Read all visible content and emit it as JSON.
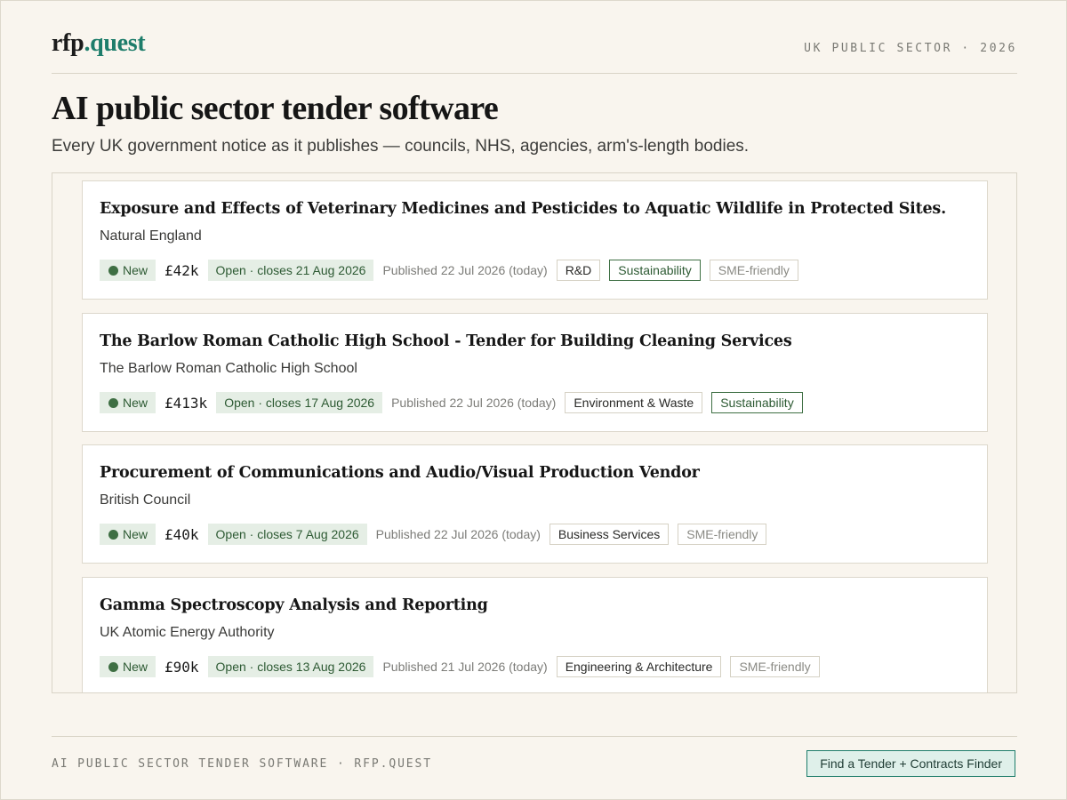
{
  "header": {
    "logo_main": "rfp",
    "logo_accent": ".quest",
    "tagline": "UK PUBLIC SECTOR · 2026"
  },
  "page": {
    "title": "AI public sector tender software",
    "subtitle": "Every UK government notice as it publishes — councils, NHS, agencies, arm's-length bodies."
  },
  "tenders": [
    {
      "title": "Exposure and Effects of Veterinary Medicines and Pesticides to Aquatic Wildlife in Protected Sites.",
      "organisation": "Natural England",
      "badge": "New",
      "value": "£42k",
      "status": "Open · closes 21 Aug 2026",
      "published": "Published 22 Jul 2026 (today)",
      "tags": [
        {
          "label": "R&D",
          "style": "default"
        },
        {
          "label": "Sustainability",
          "style": "green"
        },
        {
          "label": "SME-friendly",
          "style": "muted"
        }
      ]
    },
    {
      "title": "The Barlow Roman Catholic High School - Tender for Building Cleaning Services",
      "organisation": "The Barlow Roman Catholic High School",
      "badge": "New",
      "value": "£413k",
      "status": "Open · closes 17 Aug 2026",
      "published": "Published 22 Jul 2026 (today)",
      "tags": [
        {
          "label": "Environment & Waste",
          "style": "default"
        },
        {
          "label": "Sustainability",
          "style": "green"
        }
      ]
    },
    {
      "title": "Procurement of Communications and Audio/Visual Production Vendor",
      "organisation": "British Council",
      "badge": "New",
      "value": "£40k",
      "status": "Open · closes 7 Aug 2026",
      "published": "Published 22 Jul 2026 (today)",
      "tags": [
        {
          "label": "Business Services",
          "style": "default"
        },
        {
          "label": "SME-friendly",
          "style": "muted"
        }
      ]
    },
    {
      "title": "Gamma Spectroscopy Analysis and Reporting",
      "organisation": "UK Atomic Energy Authority",
      "badge": "New",
      "value": "£90k",
      "status": "Open · closes 13 Aug 2026",
      "published": "Published 21 Jul 2026 (today)",
      "tags": [
        {
          "label": "Engineering & Architecture",
          "style": "default"
        },
        {
          "label": "SME-friendly",
          "style": "muted"
        }
      ]
    }
  ],
  "footer": {
    "text": "AI PUBLIC SECTOR TENDER SOFTWARE · RFP.QUEST",
    "button_label": "Find a Tender + Contracts Finder"
  },
  "colors": {
    "background": "#f9f5ee",
    "accent": "#1e7d6b",
    "status_green": "#3e6f43"
  }
}
